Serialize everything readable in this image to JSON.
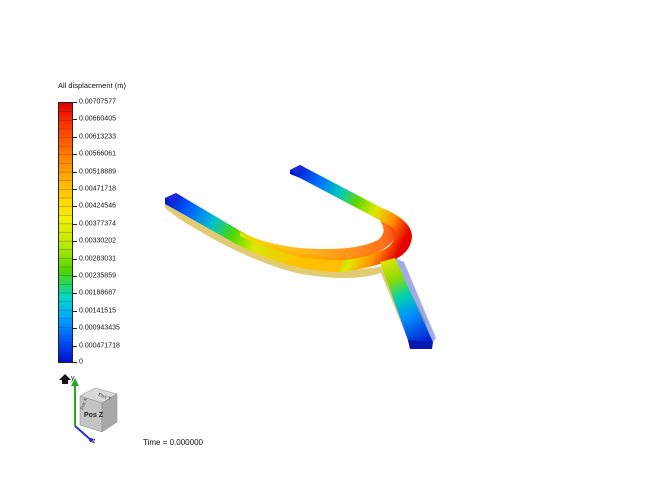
{
  "viewer": {
    "legend_title": "All displacement (m)",
    "legend_ticks": [
      "0.00707577",
      "0.00660405",
      "0.00613233",
      "0.00566061",
      "0.00518889",
      "0.00471718",
      "0.00424546",
      "0.00377374",
      "0.00330202",
      "0.00283031",
      "0.00235859",
      "0.00188687",
      "0.00141515",
      "0.000943435",
      "0.000471718",
      "0"
    ],
    "time_label": "Time = 0.000000",
    "orientation_cube": {
      "face_label": "Pos Z",
      "top_face_label": "Pos Y",
      "side_face_label": "Pos X",
      "axis_y_label": "y",
      "axis_z_label": "z"
    },
    "colors": {
      "max": "#e00000",
      "mid": "#f2f000",
      "min": "#0010c8"
    }
  }
}
